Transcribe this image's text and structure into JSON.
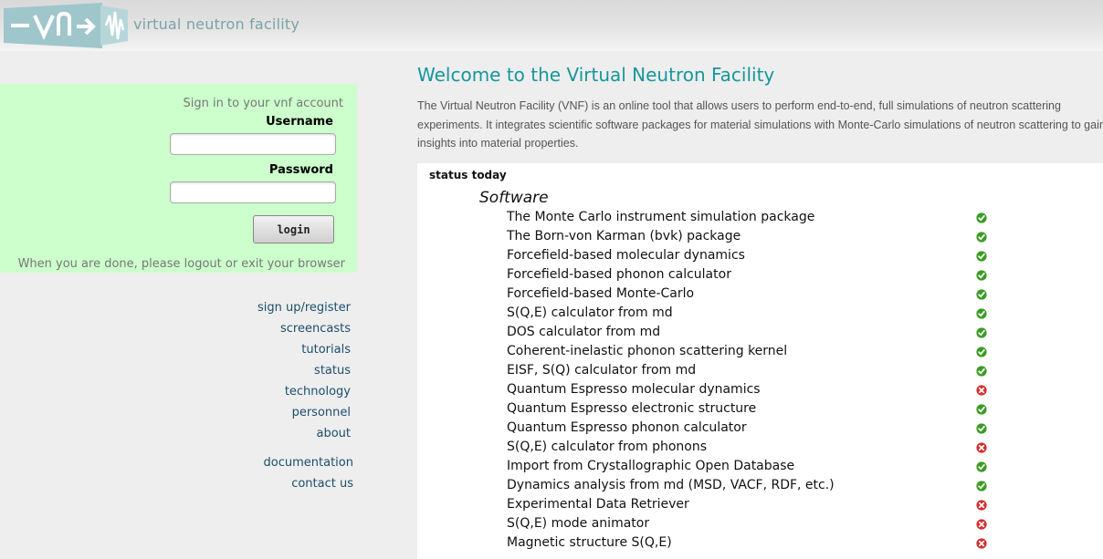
{
  "header": {
    "site_name": "virtual neutron facility",
    "logo_text": "-vnf->"
  },
  "login": {
    "prompt": "Sign in to your vnf account",
    "username_label": "Username",
    "username_value": "",
    "password_label": "Password",
    "password_value": "",
    "button_label": "login",
    "logout_note": "When you are done, please logout or exit your browser"
  },
  "nav": {
    "sign_up": "sign up/register",
    "screencasts": "screencasts",
    "tutorials": "tutorials",
    "status": "status",
    "technology": "technology",
    "personnel": "personnel",
    "about": "about",
    "documentation": "documentation",
    "contact": "contact us"
  },
  "main": {
    "title": "Welcome to the Virtual Neutron Facility",
    "intro": "The Virtual Neutron Facility (VNF) is an online tool that allows users to perform end-to-end, full simulations of neutron scattering experiments. It integrates scientific software packages for material simulations with Monte-Carlo simulations of neutron scattering to gain insights into material properties."
  },
  "status": {
    "title": "status today",
    "section": "Software",
    "items": [
      {
        "name": "The Monte Carlo instrument simulation package",
        "ok": true
      },
      {
        "name": "The Born-von Karman (bvk) package",
        "ok": true
      },
      {
        "name": "Forcefield-based molecular dynamics",
        "ok": true
      },
      {
        "name": "Forcefield-based phonon calculator",
        "ok": true
      },
      {
        "name": "Forcefield-based Monte-Carlo",
        "ok": true
      },
      {
        "name": "S(Q,E) calculator from md",
        "ok": true
      },
      {
        "name": "DOS calculator from md",
        "ok": true
      },
      {
        "name": "Coherent-inelastic phonon scattering kernel",
        "ok": true
      },
      {
        "name": "EISF, S(Q) calculator from md",
        "ok": true
      },
      {
        "name": "Quantum Espresso molecular dynamics",
        "ok": false
      },
      {
        "name": "Quantum Espresso electronic structure",
        "ok": true
      },
      {
        "name": "Quantum Espresso phonon calculator",
        "ok": true
      },
      {
        "name": "S(Q,E) calculator from phonons",
        "ok": false
      },
      {
        "name": "Import from Crystallographic Open Database",
        "ok": true
      },
      {
        "name": "Dynamics analysis from md (MSD, VACF, RDF, etc.)",
        "ok": true
      },
      {
        "name": "Experimental Data Retriever",
        "ok": false
      },
      {
        "name": "S(Q,E) mode animator",
        "ok": false
      },
      {
        "name": "Magnetic structure S(Q,E)",
        "ok": false
      }
    ]
  },
  "colors": {
    "accent": "#16969b",
    "login_bg": "#ccffcc",
    "ok": "#3a9d23",
    "error": "#d62f2f"
  },
  "icons": {
    "ok": "check-circle-icon",
    "error": "x-circle-icon"
  }
}
